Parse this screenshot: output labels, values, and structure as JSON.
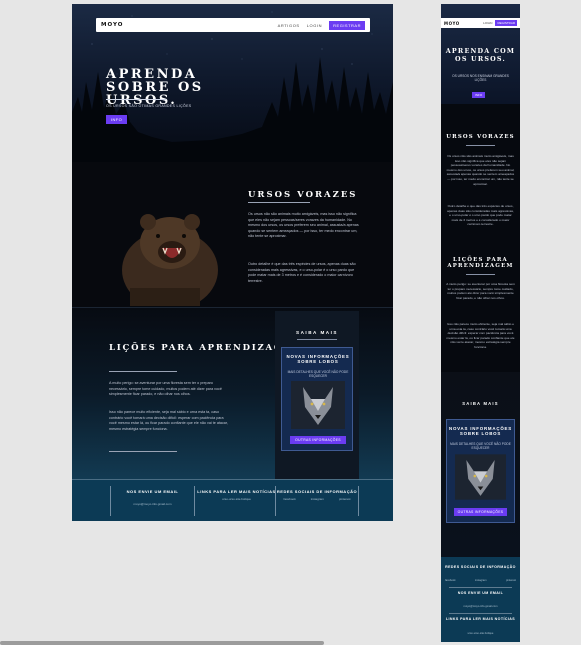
{
  "nav": {
    "logo": "MOYO",
    "articles": "ARTIGOS",
    "login": "LOGIN",
    "register": "REGISTRAR"
  },
  "hero": {
    "title": "APRENDA SOBRE OS URSOS.",
    "mobile_title": "APRENDA COM OS URSOS.",
    "subtitle": "OS URSOS SÃO ÓTIMAS GRANDES LIÇÕES",
    "mobile_subtitle": "OS URSOS NOS ENSINAM GRANDES LIÇÕES",
    "info_button": "INFO"
  },
  "bears": {
    "title": "URSOS VORAZES",
    "p1": "Os ursos não são animais muito amigáveis, mas isso não significa que eles não sejam pessoas/seres vorazes da humanidade. No mesmo dos ursos, os ursos preferem seu animal, assusta/a apenas quando se sentem ameaçados — por isso, ter medo encontrar um, não tente se aproximar.",
    "p2": "Outro detalhe é que das três espécies de ursos, apenas duas são consideradas mais agressivas, e o urso-polar é o urso pardo que pode matar mais de 3 metros e é considerado o maior carnívoro terrestre.",
    "mobile_p1": "Os ursos não são animais muito amigáveis, mas isso não significa que eles não sejam pessoas/seres vorazes da humanidade. No mesmo dos ursos, os ursos preferem seu animal, assusta/a apenas quando se sentem ameaçados — por isso, ter medo encontrar um, não tente se aproximar.",
    "mobile_p2": "Outro detalhe é que das três espécies de ursos, apenas duas são consideradas mais agressivas, e o urso-polar é o urso pardo que pode matar mais de 3 metros e é considerado o maior carnívoro terrestre."
  },
  "lessons": {
    "title": "LIÇÕES PARA APRENDIZAGEM",
    "p1": "A muito perigo: se aventurar por uma floresta sem ter o preparo necessário, sempre tome cuidado, muitos podem até dizer para você simplesmente ficar parado, e não olhar nos olhos.",
    "p2": "Isso não parece muito eficiente, seja mal sábio e urna esta ta, caso contrário você tomará uma decisão difícil: esperar com paciência para você mesmo estar lá, ou ficar parado confiante que ele não vai te atacar, mesmo estratégia sempre funciona.",
    "mobile_p1": "A muito perigo: se aventurar por uma floresta sem ter o preparo necessário, sempre tome cuidado, muitos podem até dizer para você simplesmente ficar parado, e não olhar nos olhos.",
    "mobile_p2": "Isso não parece muito eficiente, seja mal sábio e urna esta ta, caso contrário você tomará uma decisão difícil: esperar com paciência para você mesmo estar lá, ou ficar parado confiante que ele não vai te atacar, mesmo estratégia sempre funciona."
  },
  "sidebar": {
    "title": "SAIBA MAIS",
    "card_title": "NOVAS INFORMAÇÕES SOBRE LOBOS",
    "card_sub": "MAIS DETALHES QUE VOCÊ NÃO PODE ESQUECER",
    "card_button": "OUTRAS INFORMAÇÕES"
  },
  "footer": {
    "email_title": "NOS ENVIE UM EMAIL",
    "email_value": "moyo@moyo.info.gmail.com",
    "links_title": "LINKS PARA LER MAIS NOTÍCIAS",
    "links_value": "urso-urso-site.bolique",
    "social_title": "REDES SOCIAIS DE INFORMAÇÃO",
    "social": [
      "facebook",
      "instagram",
      "pinterest"
    ]
  },
  "colors": {
    "accent": "#6b3cf2",
    "footer_bg": "#0c3a55",
    "card_bg": "#142a50"
  }
}
